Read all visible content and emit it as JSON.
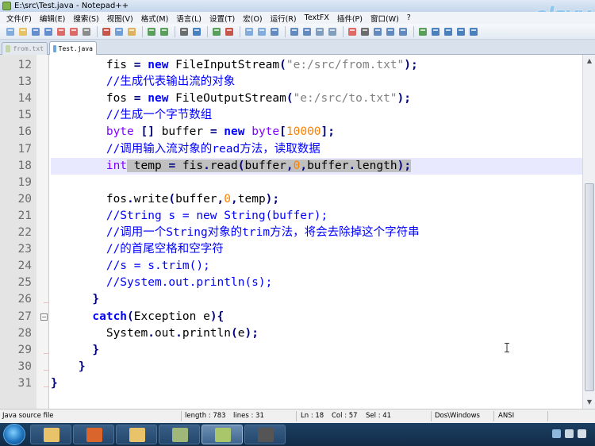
{
  "window": {
    "title": "E:\\src\\Test.java - Notepad++",
    "brand_logo_text": "elsyy"
  },
  "menu": {
    "items": [
      "文件(F)",
      "编辑(E)",
      "搜索(S)",
      "视图(V)",
      "格式(M)",
      "语言(L)",
      "设置(T)",
      "宏(O)",
      "运行(R)",
      "TextFX",
      "插件(P)",
      "窗口(W)",
      "?"
    ]
  },
  "toolbar": {
    "buttons": [
      "new-file-icon",
      "open-file-icon",
      "save-icon",
      "save-all-icon",
      "close-icon",
      "close-all-icon",
      "print-icon",
      "cut-icon",
      "copy-icon",
      "paste-icon",
      "undo-icon",
      "redo-icon",
      "find-icon",
      "replace-icon",
      "zoom-in-icon",
      "zoom-out-icon",
      "sync-vertical-icon",
      "sync-horizontal-icon",
      "word-wrap-icon",
      "show-all-chars-icon",
      "indent-guide-icon",
      "user-lang-icon",
      "doc-map-icon",
      "record-macro-icon",
      "stop-record-icon",
      "play-macro-icon",
      "run-macro-multiple-icon",
      "save-macro-icon",
      "spell-check-icon",
      "previous-icon",
      "next-icon",
      "bookmark-icon",
      "check-icon"
    ]
  },
  "tabs": [
    {
      "label": "from.txt",
      "active": false
    },
    {
      "label": "Test.java",
      "active": true
    }
  ],
  "editor": {
    "current_line": 18,
    "lines": [
      {
        "n": "12",
        "indent": "        ",
        "code": "fis = new FileInputStream(\"e:/src/from.txt\");"
      },
      {
        "n": "13",
        "indent": "        ",
        "code": "//生成代表输出流的对象"
      },
      {
        "n": "14",
        "indent": "        ",
        "code": "fos = new FileOutputStream(\"e:/src/to.txt\");"
      },
      {
        "n": "15",
        "indent": "        ",
        "code": "//生成一个字节数组"
      },
      {
        "n": "16",
        "indent": "        ",
        "code": "byte [] buffer = new byte[10000];"
      },
      {
        "n": "17",
        "indent": "        ",
        "code": "//调用输入流对象的read方法，读取数据"
      },
      {
        "n": "18",
        "indent": "        ",
        "code": "int temp = fis.read(buffer,0,buffer.length);"
      },
      {
        "n": "19",
        "indent": "",
        "code": ""
      },
      {
        "n": "20",
        "indent": "        ",
        "code": "fos.write(buffer,0,temp);"
      },
      {
        "n": "21",
        "indent": "        ",
        "code": "//String s = new String(buffer);"
      },
      {
        "n": "22",
        "indent": "        ",
        "code": "//调用一个String对象的trim方法，将会去除掉这个字符串"
      },
      {
        "n": "23",
        "indent": "        ",
        "code": "//的首尾空格和空字符"
      },
      {
        "n": "24",
        "indent": "        ",
        "code": "//s = s.trim();"
      },
      {
        "n": "25",
        "indent": "        ",
        "code": "//System.out.println(s);"
      },
      {
        "n": "26",
        "indent": "      ",
        "code": "}"
      },
      {
        "n": "27",
        "indent": "      ",
        "code": "catch(Exception e){"
      },
      {
        "n": "28",
        "indent": "        ",
        "code": "System.out.println(e);"
      },
      {
        "n": "29",
        "indent": "      ",
        "code": "}"
      },
      {
        "n": "30",
        "indent": "    ",
        "code": "}"
      },
      {
        "n": "31",
        "indent": "",
        "code": "}"
      }
    ]
  },
  "status": {
    "file_type": "Java source file",
    "length": "length : 783",
    "lines": "lines : 31",
    "ln": "Ln : 18",
    "col": "Col : 57",
    "sel": "Sel : 41",
    "eol": "Dos\\Windows",
    "encoding": "ANSI"
  },
  "colors": {
    "keyword": "#0000ff",
    "type": "#8000ff",
    "comment": "#0000ff",
    "string": "#808080",
    "number": "#ff8000",
    "current_line_bg": "#e8e8ff",
    "selection_bg": "#c0c0c0"
  },
  "taskbar": {
    "apps": [
      "explorer-icon",
      "powerpoint-icon",
      "folder-icon",
      "book-icon",
      "notepad-plus-plus-icon",
      "media-icon"
    ],
    "active_index": 4
  }
}
